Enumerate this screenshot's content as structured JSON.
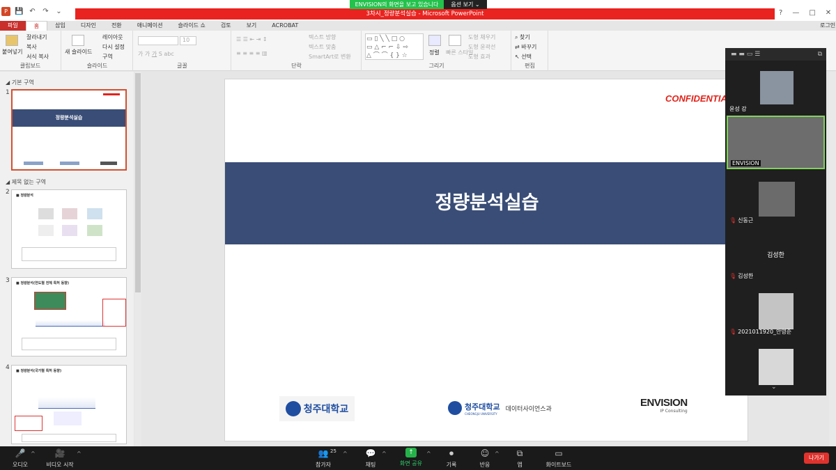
{
  "window": {
    "doc_title": "3차시_정량분석실습 - Microsoft PowerPoint",
    "share_banner": "ENVISION의 화면을 보고 있습니다",
    "options_label": "옵션 보기 ⌄",
    "login": "로그인"
  },
  "tabs": [
    "파일",
    "홈",
    "삽입",
    "디자인",
    "전환",
    "애니메이션",
    "슬라이드 쇼",
    "검토",
    "보기",
    "ACROBAT"
  ],
  "ribbon": {
    "clipboard": {
      "paste": "붙여넣기",
      "cut": "잘라내기",
      "copy": "복사",
      "format": "서식 복사",
      "label": "클립보드"
    },
    "slides": {
      "new": "새 슬라이드",
      "layout": "레이아웃",
      "reset": "다시 설정",
      "section": "구역",
      "label": "슬라이드"
    },
    "font": {
      "size": "10",
      "label": "글꼴"
    },
    "paragraph": {
      "text_dir": "텍스트 방향",
      "text_align": "텍스트 맞춤",
      "smartart": "SmartArt로 변환",
      "label": "단락"
    },
    "drawing": {
      "arrange": "정렬",
      "quick_styles": "빠른 스타일",
      "fill": "도형 채우기",
      "outline": "도형 윤곽선",
      "effects": "도형 효과",
      "label": "그리기"
    },
    "editing": {
      "find": "찾기",
      "replace": "바꾸기",
      "select": "선택",
      "label": "편집"
    }
  },
  "thumbpane": {
    "section1": "기본 구역",
    "section2": "제목 없는 구역",
    "slide_numbers": [
      "1",
      "2",
      "3",
      "4"
    ],
    "thumb_titles": [
      "정량분석실습",
      "■ 정량분석",
      "■ 정량분석(연도별 전체 특허 동향)",
      "■ 정량분석(국가별 특허 동향)"
    ]
  },
  "slide": {
    "confidential": "CONFIDENTIAL",
    "title": "정량분석실습",
    "logo1": "청주대학교",
    "logo2": "청주대학교",
    "logo2_sub": "CHEONGJU UNIVERSITY",
    "dept": "데이터사이언스과",
    "logo3": "ENVISION",
    "logo3_sub": "IP Consulting"
  },
  "gallery": {
    "participants": [
      "윤성 강",
      "ENVISION",
      "신동근",
      "김성한",
      "2021011920_안영준",
      ""
    ],
    "tile_center_name": "김성한"
  },
  "taskbar": {
    "audio": "오디오",
    "video": "비디오 시작",
    "participants": "참가자",
    "participant_count": "25",
    "chat": "채팅",
    "share": "화면 공유",
    "record": "기록",
    "reactions": "반응",
    "apps": "앱",
    "whiteboard": "화이트보드",
    "leave": "나가기"
  },
  "colors": {
    "accent_red": "#e9231f",
    "slide_band": "#394d76",
    "share_green": "#23c24c"
  }
}
